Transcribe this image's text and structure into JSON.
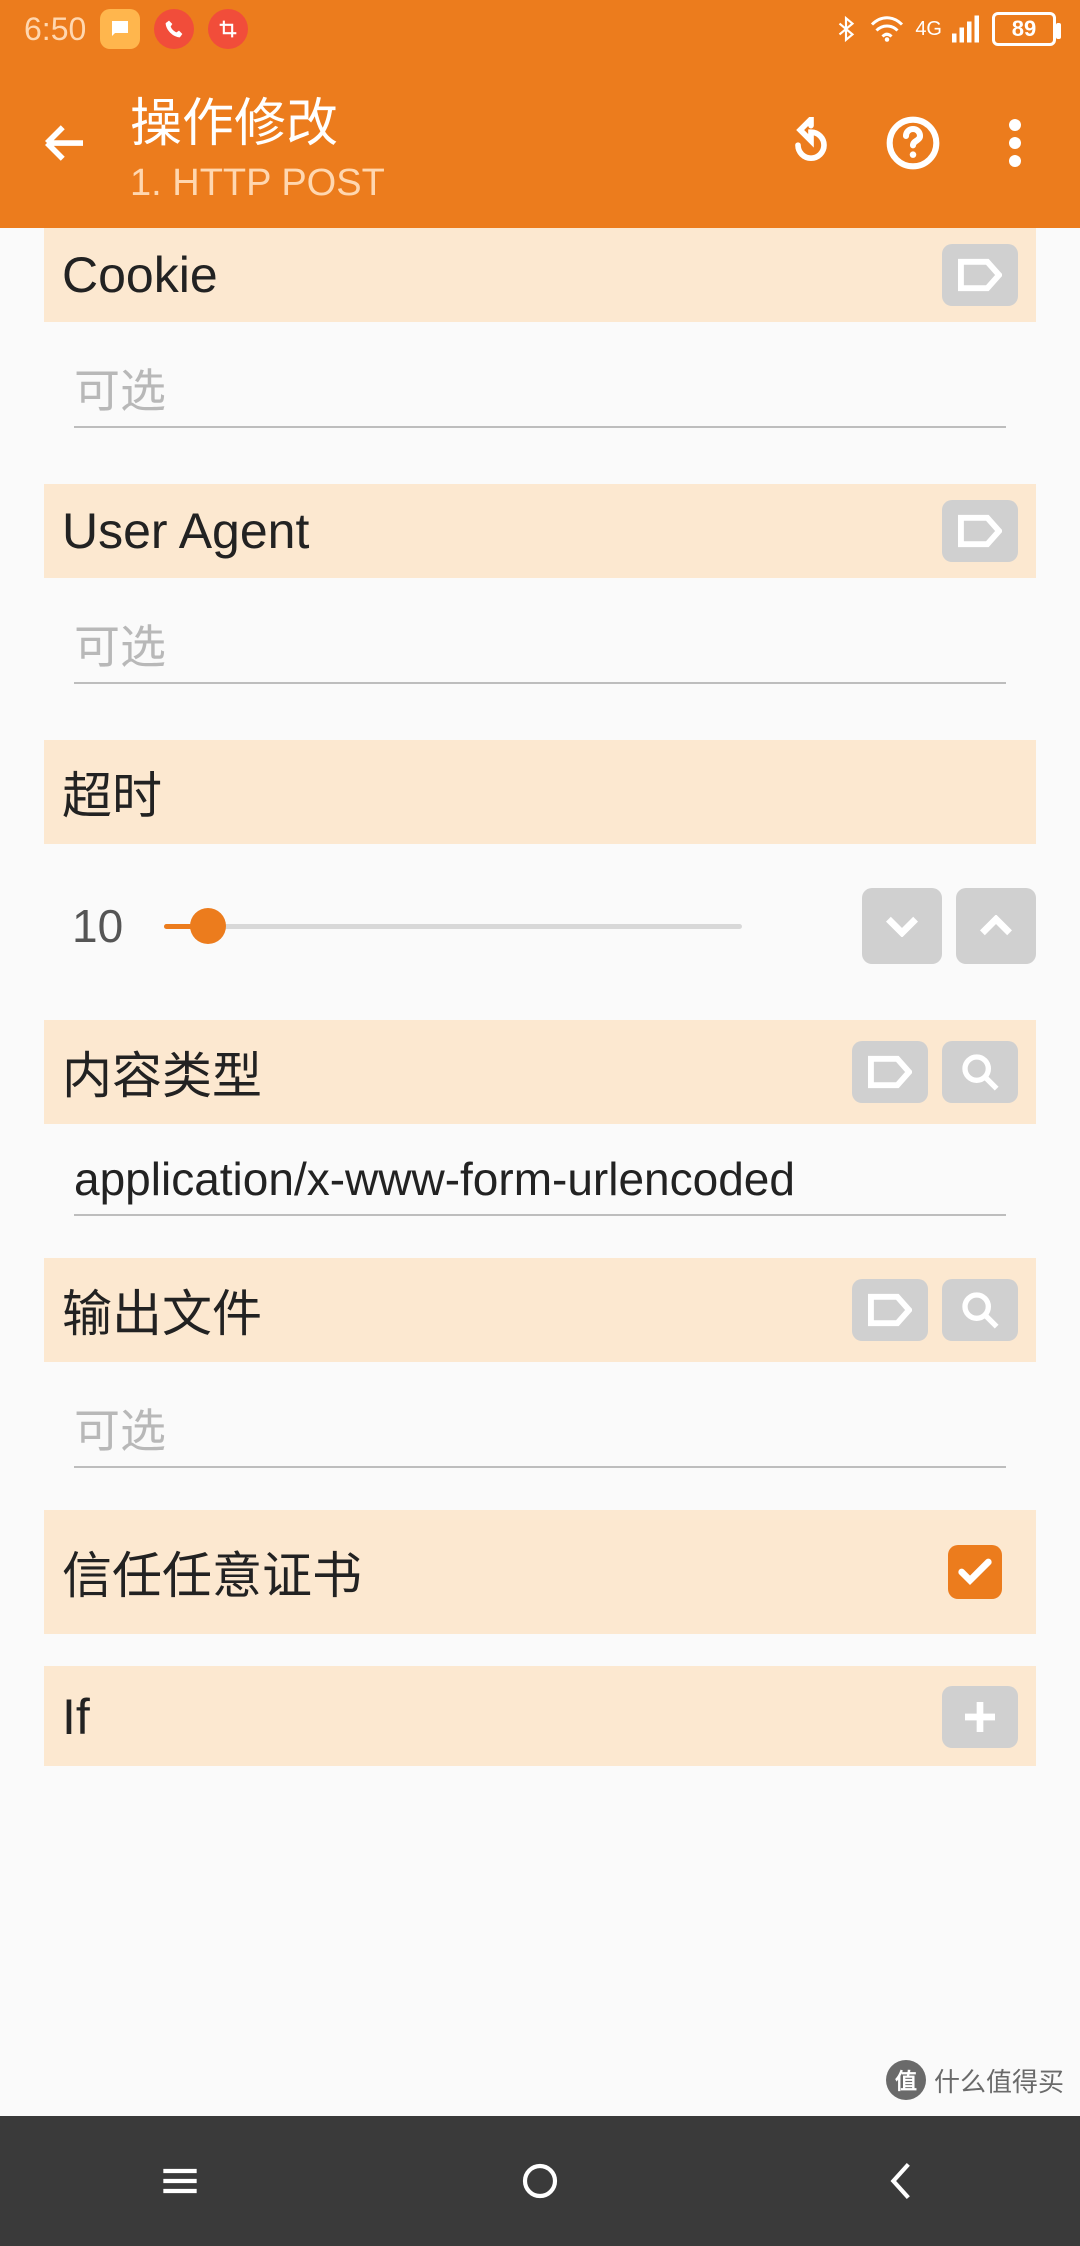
{
  "status": {
    "time": "6:50",
    "signal_label": "4G",
    "battery": "89"
  },
  "header": {
    "title": "操作修改",
    "subtitle": "1. HTTP POST"
  },
  "sections": {
    "cookie": {
      "title": "Cookie",
      "placeholder": "可选",
      "value": ""
    },
    "user_agent": {
      "title": "User Agent",
      "placeholder": "可选",
      "value": ""
    },
    "timeout": {
      "title": "超时",
      "value": "10"
    },
    "content_type": {
      "title": "内容类型",
      "value": "application/x-www-form-urlencoded"
    },
    "output_file": {
      "title": "输出文件",
      "placeholder": "可选",
      "value": ""
    },
    "trust_cert": {
      "title": "信任任意证书",
      "checked": true
    },
    "if": {
      "title": "If"
    }
  },
  "watermark": "什么值得买"
}
